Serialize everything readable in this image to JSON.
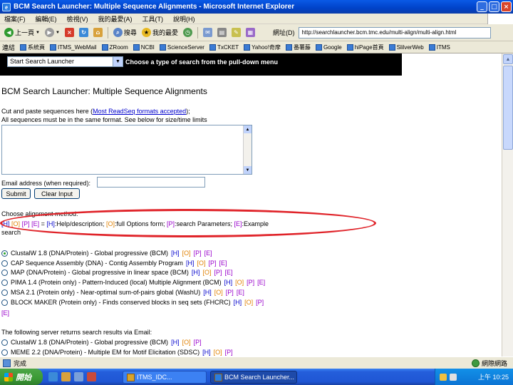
{
  "window": {
    "title": "BCM Search Launcher: Multiple Sequence Alignments - Microsoft Internet Explorer",
    "buttons": [
      "_",
      "□",
      "×"
    ]
  },
  "menu": [
    "檔案(F)",
    "編輯(E)",
    "檢視(V)",
    "我的最愛(A)",
    "工具(T)",
    "說明(H)"
  ],
  "toolbar": {
    "back_label": "上一頁",
    "search_label": "搜尋",
    "favorites_label": "我的最愛",
    "address_label": "網址(D)",
    "address_value": "http://searchlauncher.bcm.tmc.edu/multi-align/multi-align.html"
  },
  "links_bar": {
    "label": "連結",
    "items": [
      "系統頁",
      "ITMS_WebMail",
      "ZRoom",
      "NCBI",
      "ScienceServer",
      "TxCKET",
      "Yahoo!奇摩",
      "番薯藤",
      "Google",
      "hiPage首頁",
      "SlilverWeb",
      "ITMS"
    ]
  },
  "launcher": {
    "selected": "Start Search Launcher",
    "arrow": "▼",
    "hint": "Choose a type of search from the pull-down menu"
  },
  "page": {
    "title": "BCM Search Launcher: Multiple Sequence Alignments",
    "intro_before": "Cut and paste sequences here (",
    "intro_link": "Most ReadSeq formats accepted",
    "intro_after": ");",
    "intro2": "All sequences must be in the same format. See below for size/time limits",
    "email_label": "Email address (when required):",
    "submit_label": "Submit",
    "clear_label": "Clear Input",
    "method_heading": "Choose alignment method:",
    "legend": {
      "l1": "[H]",
      "l2": "[O]",
      "l3": "[P]",
      "l4": "[E]",
      "eq": " = ",
      "h_tag": "[H]",
      "h_text": ":Help/description; ",
      "o_tag": "[O]",
      "o_text": ":full Options form; ",
      "p_tag": "[P]",
      "p_text": ":search Parameters; ",
      "e_tag": "[E]",
      "e_text": ":Example"
    },
    "legend_cont": "search",
    "options": [
      {
        "label": "ClustalW 1.8 (DNA/Protein) - Global progressive (BCM)",
        "checked": true
      },
      {
        "label": "CAP Sequence Assembly (DNA) - Contig Assembly Program",
        "checked": false
      },
      {
        "label": "MAP (DNA/Protein) - Global progressive in linear space (BCM)",
        "checked": false
      },
      {
        "label": "PIMA 1.4 (Protein only) - Pattern-Induced (local) Multiple Alignment (BCM)",
        "checked": false
      },
      {
        "label": "MSA 2.1 (Protein only) - Near-optimal sum-of-pairs global (WashU)",
        "checked": false
      },
      {
        "label": "BLOCK MAKER (Protein only) - Finds conserved blocks in seq sets (FHCRC)",
        "checked": false
      }
    ],
    "orphan_tag": "[E]",
    "email_heading": "The following server returns search results via Email:",
    "email_options": [
      {
        "label": "ClustalW 1.8 (DNA/Protein) - Global progressive (BCM)"
      },
      {
        "label": "MEME 2.2 (DNA/Protein) - Multiple EM for Motif Elicitation (SDSC)"
      }
    ],
    "tags": {
      "h": "[H]",
      "o": "[O]",
      "p": "[P]",
      "e": "[E]"
    }
  },
  "status": {
    "text": "完成",
    "zone": "網際網路"
  },
  "taskbar": {
    "start": "開始",
    "tasks": [
      "ITMS_IDC...",
      "BCM Search Launcher..."
    ],
    "clock": "上午 10:25"
  }
}
